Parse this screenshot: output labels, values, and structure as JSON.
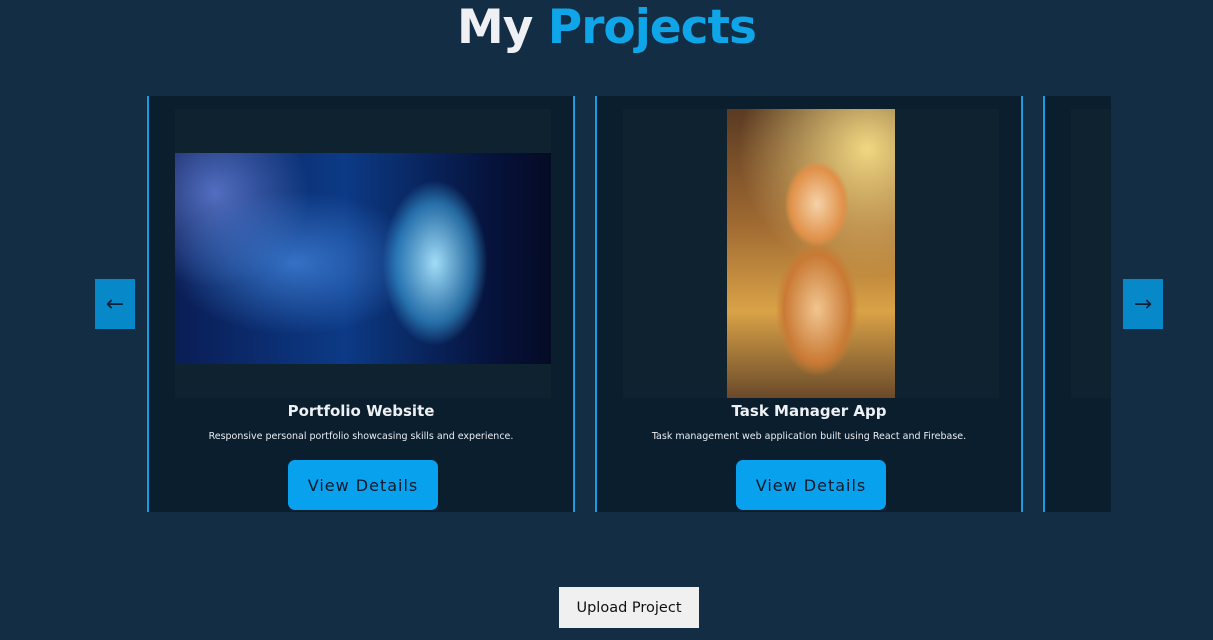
{
  "header": {
    "title_part1": "My",
    "title_part2": "Projects"
  },
  "carousel": {
    "prev_label": "←",
    "next_label": "→",
    "cards": [
      {
        "title": "Portfolio Website",
        "description": "Responsive personal portfolio showcasing skills and experience.",
        "button_label": "View Details",
        "image": "blue-particle-face-image"
      },
      {
        "title": "Task Manager App",
        "description": "Task management web application built using React and Firebase.",
        "button_label": "View Details",
        "image": "tiger-cub-image"
      }
    ]
  },
  "upload": {
    "label": "Upload Project"
  },
  "colors": {
    "background": "#132d45",
    "accent": "#0ea5e9",
    "card_bg": "#0b1e2e",
    "card_border": "#1e9be0"
  }
}
